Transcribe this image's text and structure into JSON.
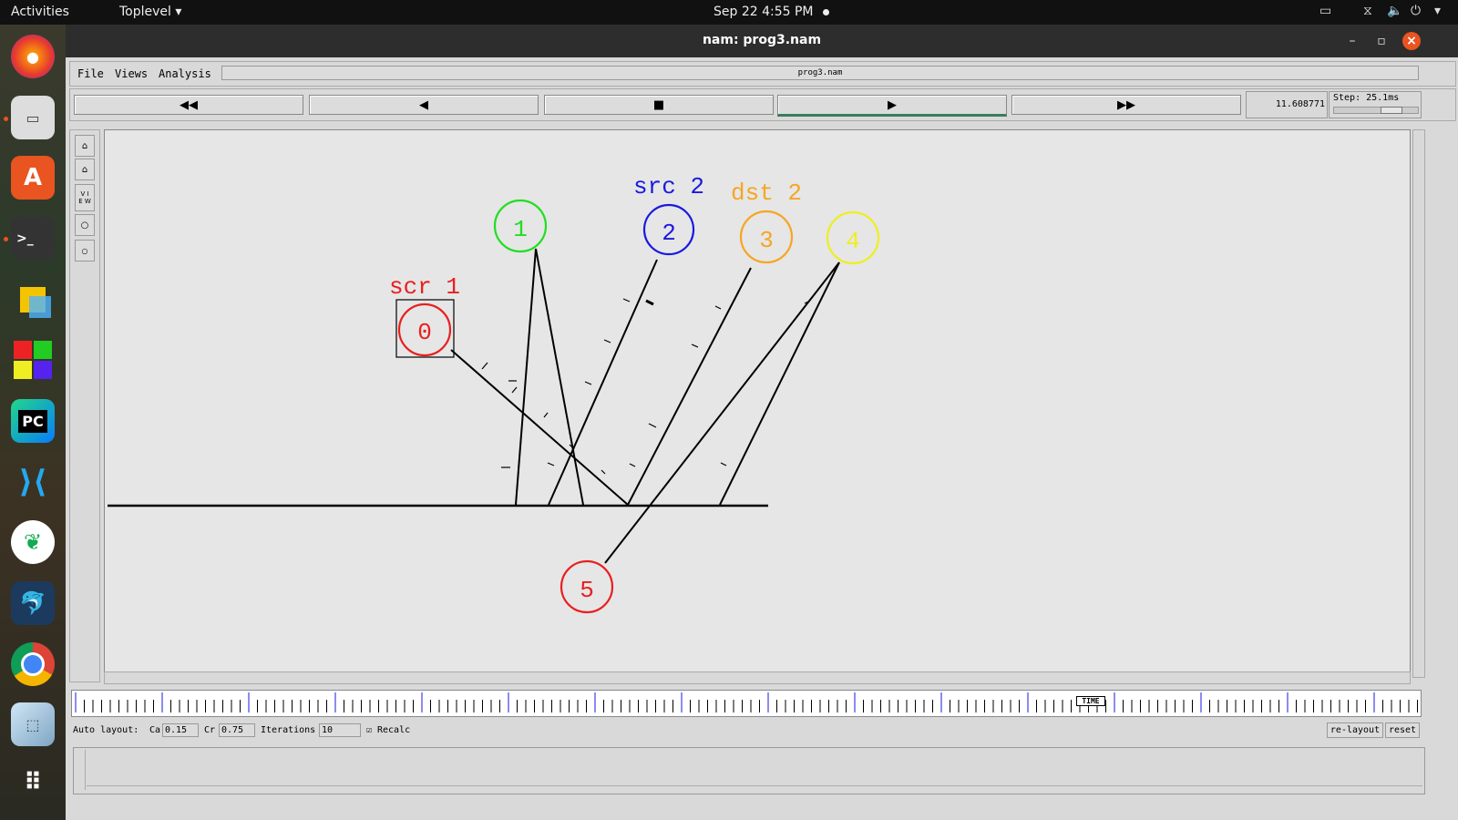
{
  "topbar": {
    "activities": "Activities",
    "toplevel": "Toplevel",
    "clock": "Sep 22  4:55 PM"
  },
  "dock": {
    "icons": [
      "firefox-icon",
      "files-icon",
      "app-center-icon",
      "terminal-icon",
      "sticky-notes-icon",
      "windows-app-icon",
      "pycharm-icon",
      "vscode-icon",
      "mongodb-compass-icon",
      "mysql-workbench-icon",
      "chrome-icon",
      "virtual-box-icon",
      "app-grid-icon"
    ]
  },
  "window": {
    "title": "nam: prog3.nam",
    "menu": {
      "file": "File",
      "views": "Views",
      "analysis": "Analysis"
    },
    "filename": "prog3.nam",
    "time": "11.608771",
    "step": "Step: 25.1ms",
    "step_level": 0.75
  },
  "canvas": {
    "nodes": [
      {
        "id": "0",
        "color": "#e82020",
        "label": "scr 1"
      },
      {
        "id": "1",
        "color": "#22dd22",
        "label": ""
      },
      {
        "id": "2",
        "color": "#1a1ae0",
        "label": "src 2"
      },
      {
        "id": "3",
        "color": "#f5a623",
        "label": "dst 2"
      },
      {
        "id": "4",
        "color": "#eeee22",
        "label": ""
      },
      {
        "id": "5",
        "color": "#e82020",
        "label": ""
      }
    ]
  },
  "timeline": {
    "marker": "TIME"
  },
  "autolayout": {
    "label": "Auto layout:",
    "ca_label": "Ca",
    "ca_value": "0.15",
    "cr_label": "Cr",
    "cr_value": "0.75",
    "iterations_label": "Iterations",
    "iterations_value": "10",
    "recalc_label": "Recalc",
    "relayout": "re-layout",
    "reset": "reset"
  }
}
